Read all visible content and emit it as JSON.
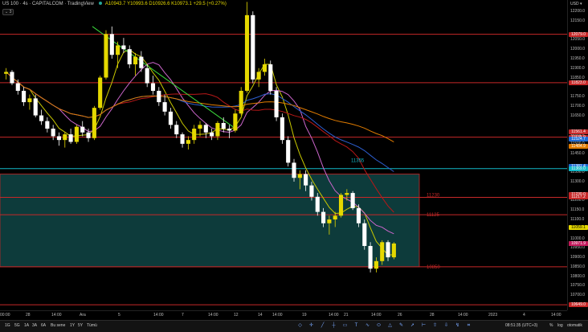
{
  "legend": {
    "symbol": "US 100 · 4s · CAPITALCOM · TradingView",
    "ohlc": "A10943.7 Y10993.6 D10926.6 K10973.1 +29.5 (+0.27%)",
    "collapse": "⌄ 3"
  },
  "currency": "USD ▾",
  "price_ticks": [
    "12200.0",
    "12150.0",
    "12050.0",
    "12000.0",
    "11950.0",
    "11900.0",
    "11850.0",
    "11750.0",
    "11700.0",
    "11650.0",
    "11550.0",
    "11500.0",
    "11450.0",
    "11350.0",
    "11300.0",
    "11200.0",
    "11150.0",
    "11100.0",
    "11050.0",
    "11000.0",
    "10950.0",
    "10900.0",
    "10850.0",
    "10800.0",
    "10750.0",
    "10700.0",
    "10650.0"
  ],
  "price_badges": [
    {
      "text": "12079.0",
      "color": "#c62828"
    },
    {
      "text": "11823.0",
      "color": "#c62828"
    },
    {
      "text": "11561.4",
      "color": "#c62828"
    },
    {
      "text": "11535.0",
      "color": "#c62828"
    },
    {
      "text": "11524.7",
      "color": "#1e6bd6"
    },
    {
      "text": "11484.9",
      "color": "#e07b00"
    },
    {
      "text": "11381.4",
      "color": "#1e6bd6"
    },
    {
      "text": "11369.0",
      "color": "#13b8c7"
    },
    {
      "text": "11230.0",
      "color": "#c62828"
    },
    {
      "text": "11217.2",
      "color": "#c62828"
    },
    {
      "text": "11059.1",
      "color": "#e5d800"
    },
    {
      "text": "10973.1",
      "color": "#e5d800"
    },
    {
      "text": "10971.9",
      "color": "#c2185b"
    },
    {
      "text": "10649.0",
      "color": "#c62828"
    }
  ],
  "hline_labels": {
    "l11355": "11355",
    "l11230": "11230",
    "l11125": "11125",
    "l10850": "10850"
  },
  "time_ticks": [
    "00:00",
    "28",
    "14:00",
    "Ara",
    "5",
    "14:00",
    "7",
    "14:00",
    "12",
    "14",
    "14:00",
    "19",
    "14:00",
    "21",
    "14:00",
    "26",
    "28",
    "14:00",
    "2023",
    "4",
    "14:00"
  ],
  "ranges": [
    "1G",
    "5G",
    "1A",
    "3A",
    "6A",
    "Bu sene",
    "1Y",
    "5Y",
    "Tümü"
  ],
  "tools": [
    "select-icon",
    "cursor-icon",
    "trendline-icon",
    "horizontal-line-icon",
    "rectangle-icon",
    "text-icon",
    "path-icon",
    "ellipse-icon",
    "triangle-icon",
    "brush-icon",
    "arrow-icon",
    "ruler-icon",
    "long-position-icon",
    "short-position-icon",
    "forecast-icon",
    "measure-icon"
  ],
  "clock": "08:51:35 (UTC+3)",
  "percent": "%",
  "log": "log",
  "auto": "otomatik",
  "colors": {
    "bull": "#e5d800",
    "bear": "#ffffff",
    "zone": "#0d3b3b",
    "res": "#c62828",
    "cyan": "#13b8c7"
  },
  "chart_data": {
    "type": "candlestick",
    "symbol": "US 100",
    "interval": "4s",
    "ylim": [
      10620,
      12260
    ],
    "candles": [
      [
        11870,
        11900,
        11840,
        11880
      ],
      [
        11880,
        11890,
        11810,
        11820
      ],
      [
        11820,
        11840,
        11760,
        11780
      ],
      [
        11780,
        11800,
        11700,
        11720
      ],
      [
        11720,
        11760,
        11680,
        11740
      ],
      [
        11740,
        11760,
        11640,
        11650
      ],
      [
        11650,
        11680,
        11600,
        11620
      ],
      [
        11620,
        11640,
        11560,
        11580
      ],
      [
        11580,
        11600,
        11520,
        11540
      ],
      [
        11540,
        11560,
        11490,
        11520
      ],
      [
        11520,
        11560,
        11480,
        11550
      ],
      [
        11550,
        11580,
        11500,
        11510
      ],
      [
        11510,
        11600,
        11500,
        11590
      ],
      [
        11590,
        11620,
        11540,
        11560
      ],
      [
        11560,
        11580,
        11510,
        11530
      ],
      [
        11530,
        11700,
        11520,
        11690
      ],
      [
        11690,
        11860,
        11680,
        11850
      ],
      [
        11850,
        12100,
        11840,
        12080
      ],
      [
        12080,
        12120,
        11950,
        11970
      ],
      [
        11970,
        12040,
        11900,
        12020
      ],
      [
        12020,
        12060,
        11980,
        12000
      ],
      [
        12000,
        12020,
        11900,
        11920
      ],
      [
        11920,
        11980,
        11860,
        11960
      ],
      [
        11960,
        11990,
        11880,
        11900
      ],
      [
        11900,
        11920,
        11800,
        11820
      ],
      [
        11820,
        11860,
        11760,
        11780
      ],
      [
        11780,
        11800,
        11700,
        11720
      ],
      [
        11720,
        11760,
        11650,
        11670
      ],
      [
        11670,
        11690,
        11580,
        11600
      ],
      [
        11600,
        11620,
        11530,
        11550
      ],
      [
        11550,
        11560,
        11480,
        11500
      ],
      [
        11500,
        11540,
        11470,
        11520
      ],
      [
        11520,
        11600,
        11500,
        11580
      ],
      [
        11580,
        11620,
        11540,
        11600
      ],
      [
        11600,
        11610,
        11530,
        11560
      ],
      [
        11560,
        11580,
        11520,
        11540
      ],
      [
        11540,
        11620,
        11520,
        11610
      ],
      [
        11610,
        11640,
        11560,
        11580
      ],
      [
        11580,
        11600,
        11530,
        11570
      ],
      [
        11570,
        11680,
        11560,
        11660
      ],
      [
        11660,
        11800,
        11650,
        11780
      ],
      [
        11780,
        12250,
        11770,
        12180
      ],
      [
        12180,
        12200,
        11820,
        11840
      ],
      [
        11840,
        11900,
        11800,
        11880
      ],
      [
        11880,
        11950,
        11860,
        11920
      ],
      [
        11920,
        11940,
        11760,
        11780
      ],
      [
        11780,
        11800,
        11620,
        11640
      ],
      [
        11640,
        11660,
        11500,
        11520
      ],
      [
        11520,
        11540,
        11380,
        11400
      ],
      [
        11400,
        11420,
        11300,
        11320
      ],
      [
        11320,
        11360,
        11260,
        11340
      ],
      [
        11340,
        11360,
        11250,
        11280
      ],
      [
        11280,
        11300,
        11200,
        11220
      ],
      [
        11220,
        11240,
        11120,
        11140
      ],
      [
        11140,
        11160,
        11060,
        11080
      ],
      [
        11080,
        11120,
        11020,
        11100
      ],
      [
        11100,
        11140,
        11060,
        11120
      ],
      [
        11120,
        11240,
        11110,
        11230
      ],
      [
        11230,
        11260,
        11200,
        11240
      ],
      [
        11240,
        11250,
        11150,
        11160
      ],
      [
        11160,
        11180,
        11060,
        11080
      ],
      [
        11080,
        11100,
        10940,
        10960
      ],
      [
        10960,
        10980,
        10820,
        10840
      ],
      [
        10840,
        10900,
        10820,
        10880
      ],
      [
        10880,
        10990,
        10860,
        10980
      ],
      [
        10980,
        10990,
        10880,
        10900
      ],
      [
        10900,
        10980,
        10890,
        10973
      ]
    ],
    "horizontal_lines": [
      {
        "label": "",
        "price": 12079,
        "color": "#c62828"
      },
      {
        "label": "",
        "price": 11823,
        "color": "#c62828"
      },
      {
        "label": "",
        "price": 11535,
        "color": "#c62828"
      },
      {
        "label": "11355",
        "price": 11369,
        "color": "#13b8c7"
      },
      {
        "label": "11230",
        "price": 11217,
        "color": "#c62828"
      },
      {
        "label": "11125",
        "price": 11125,
        "color": "#c62828"
      },
      {
        "label": "10850",
        "price": 10850,
        "color": "#c62828"
      },
      {
        "label": "",
        "price": 10649,
        "color": "#c62828"
      }
    ],
    "zone": {
      "top": 11340,
      "bottom": 10850
    },
    "trendline": [
      [
        12120,
        0.16
      ],
      [
        11600,
        0.4
      ]
    ]
  }
}
